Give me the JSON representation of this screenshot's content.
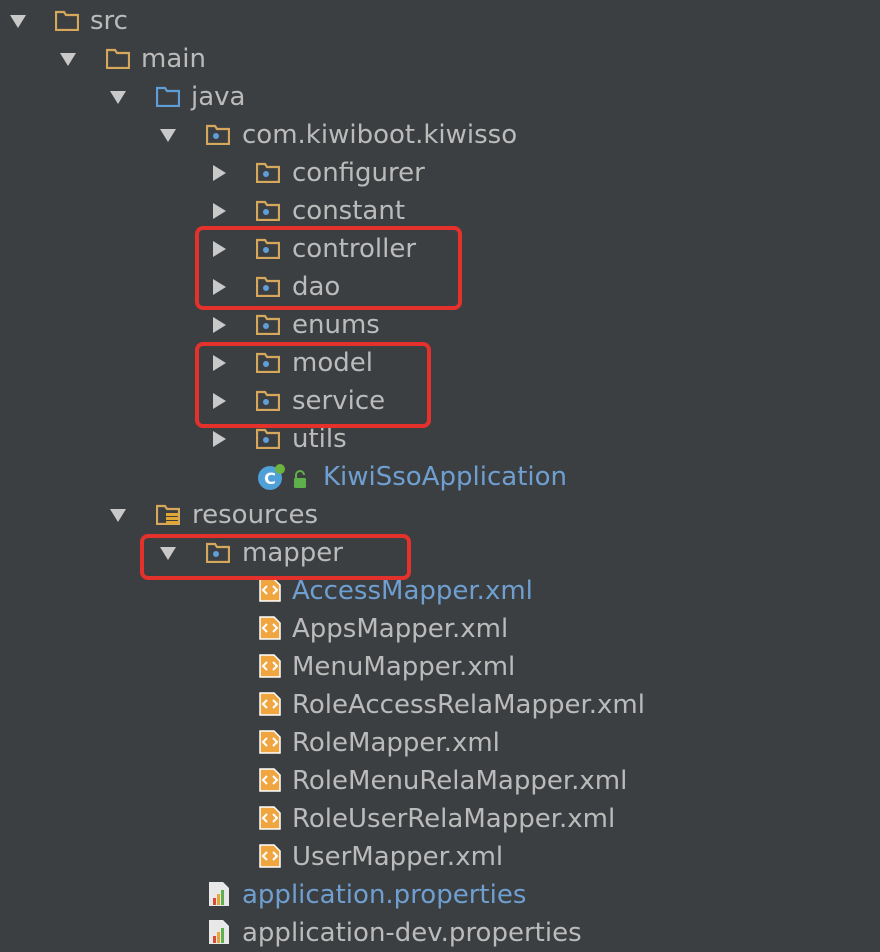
{
  "colors": {
    "background": "#3c3f41",
    "text": "#bbbbbb",
    "link_text": "#6f9fd1",
    "folder": "#d6a85c",
    "java_folder": "#5f9ed6",
    "highlight": "#e4312b"
  },
  "tree": {
    "src": "src",
    "main": "main",
    "java": "java",
    "package": "com.kiwiboot.kiwisso",
    "configurer": "configurer",
    "constant": "constant",
    "controller": "controller",
    "dao": "dao",
    "enums": "enums",
    "model": "model",
    "service": "service",
    "utils": "utils",
    "application_class": "KiwiSsoApplication",
    "resources": "resources",
    "mapper": "mapper",
    "mapper_files": [
      "AccessMapper.xml",
      "AppsMapper.xml",
      "MenuMapper.xml",
      "RoleAccessRelaMapper.xml",
      "RoleMapper.xml",
      "RoleMenuRelaMapper.xml",
      "RoleUserRelaMapper.xml",
      "UserMapper.xml"
    ],
    "properties_files": [
      "application.properties",
      "application-dev.properties"
    ]
  }
}
